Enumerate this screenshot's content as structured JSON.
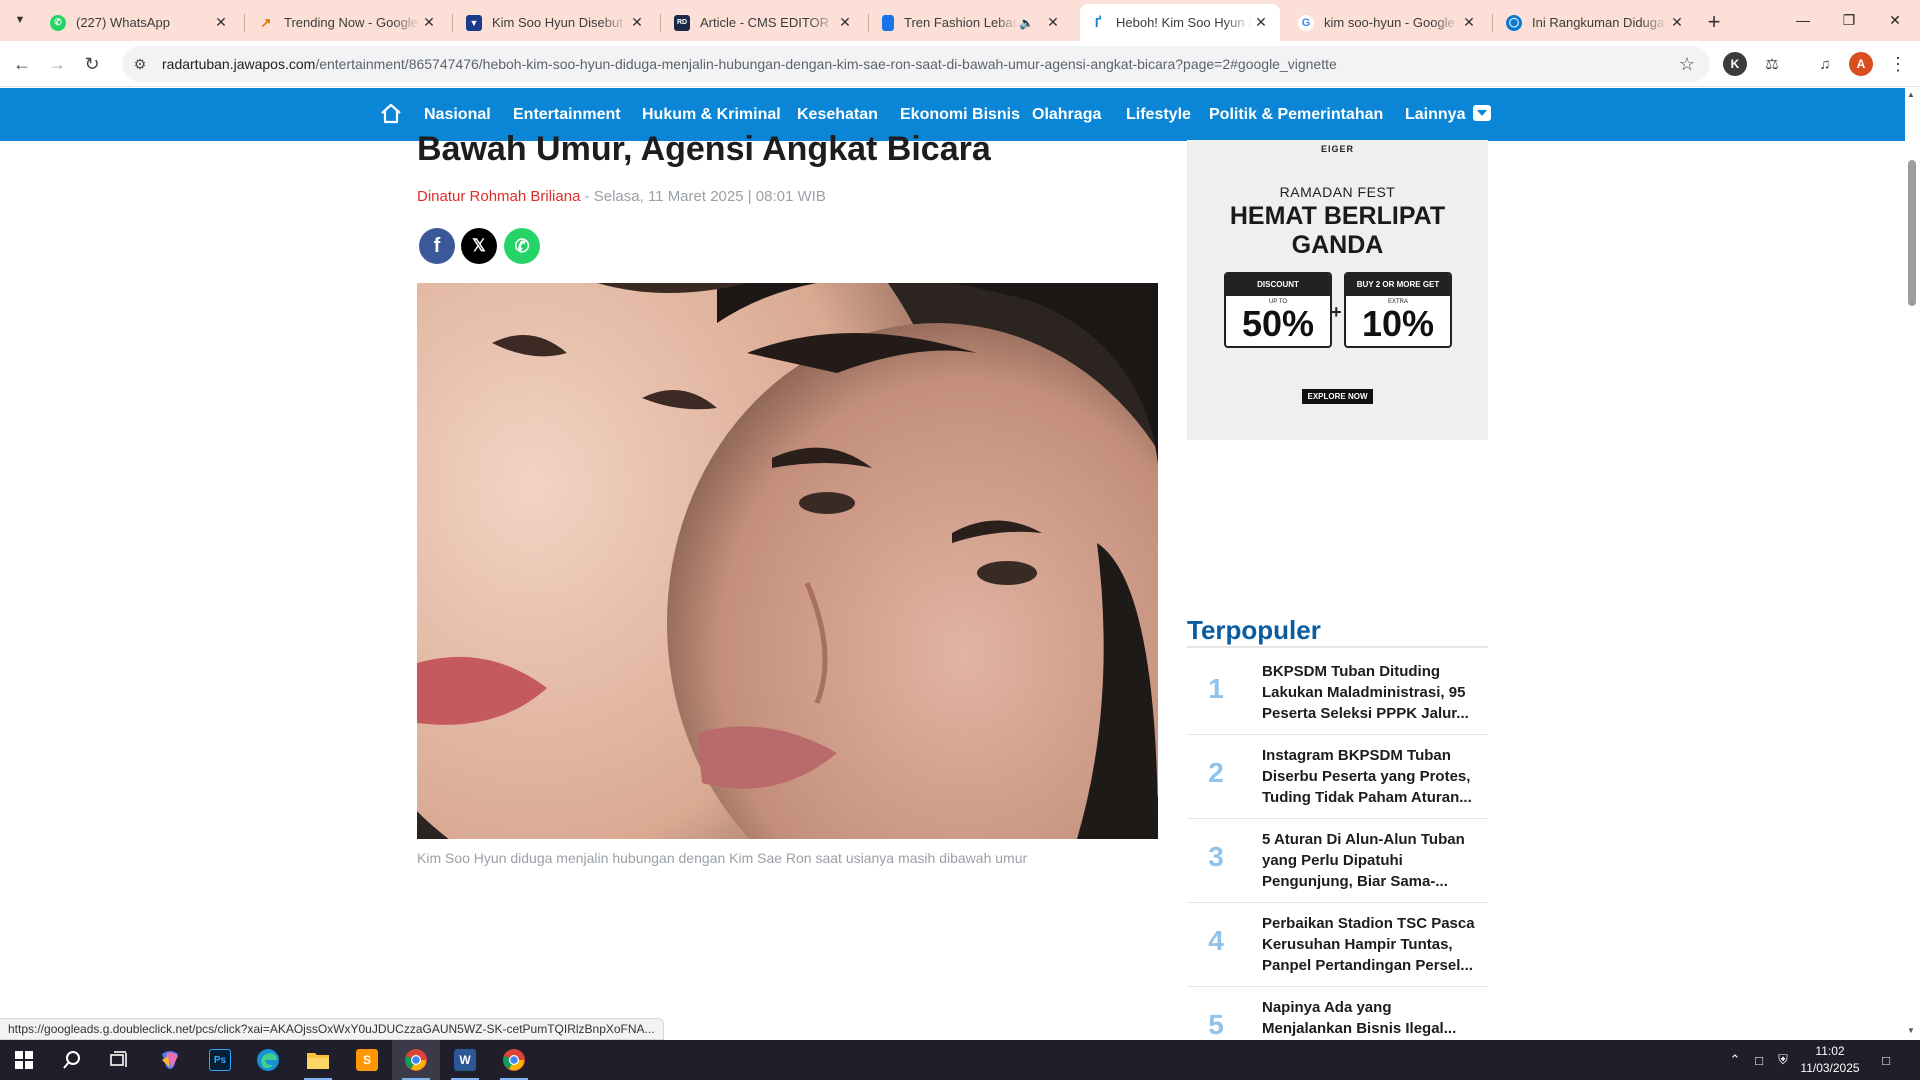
{
  "browser": {
    "tabs": [
      {
        "title": "(227) WhatsApp",
        "favicon": "whatsapp-icon",
        "color": "#25d366"
      },
      {
        "title": "Trending Now - Google Tr",
        "favicon": "google-trends-icon",
        "color": "#e37400"
      },
      {
        "title": "Kim Soo Hyun Disebut Pa",
        "favicon": "site-logo-icon",
        "color": "#1a3a8a"
      },
      {
        "title": "Article - CMS EDITOR",
        "favicon": "cms-icon",
        "color": "#1b2a4a"
      },
      {
        "title": "Tren Fashion Lebaran",
        "favicon": "bookmark-icon",
        "color": "#1a73e8"
      },
      {
        "title": "Heboh! Kim Soo Hyun Di",
        "favicon": "radar-icon",
        "color": "#0b86d6"
      },
      {
        "title": "kim soo-hyun - Google Se",
        "favicon": "google-icon",
        "color": "#4285f4"
      },
      {
        "title": "Ini Rangkuman Diduga Pe",
        "favicon": "globe-icon",
        "color": "#0a7bd0"
      }
    ],
    "active_tab": 5,
    "url_host": "radartuban.jawapos.com",
    "url_path": "/entertainment/865747476/heboh-kim-soo-hyun-diduga-menjalin-hubungan-dengan-kim-sae-ron-saat-di-bawah-umur-agensi-angkat-bicara?page=2#google_vignette",
    "profile_initial": "A",
    "extension_initial": "K"
  },
  "site": {
    "nav": [
      "Nasional",
      "Entertainment",
      "Hukum & Kriminal",
      "Kesehatan",
      "Ekonomi Bisnis",
      "Olahraga",
      "Lifestyle",
      "Politik & Pemerintahan",
      "Lainnya"
    ],
    "brand_color": "#0b86d6"
  },
  "article": {
    "headline": "Bawah Umur, Agensi Angkat Bicara",
    "author": "Dinatur Rohmah Briliana",
    "date": " - Selasa, 11 Maret 2025 | 08:01 WIB",
    "caption": "Kim Soo Hyun diduga menjalin hubungan dengan Kim Sae Ron saat usianya masih dibawah umur"
  },
  "ad": {
    "brand": "EIGER",
    "event": "RAMADAN FEST",
    "headline_1": "HEMAT BERLIPAT",
    "headline_2": "GANDA",
    "box1_header": "DISCOUNT",
    "box1_sub": "UP TO",
    "box1_value": "50%",
    "box2_header": "BUY 2 OR MORE GET",
    "box2_sub": "EXTRA",
    "box2_value": "10%",
    "plus": "+",
    "cta": "EXPLORE NOW"
  },
  "sidebar": {
    "popular_title": "Terpopuler",
    "popular": [
      {
        "rank": "1",
        "title": "BKPSDM Tuban Dituding Lakukan Maladministrasi, 95 Peserta Seleksi PPPK Jalur..."
      },
      {
        "rank": "2",
        "title": "Instagram BKPSDM Tuban Diserbu Peserta yang Protes, Tuding Tidak Paham Aturan..."
      },
      {
        "rank": "3",
        "title": "5 Aturan Di Alun-Alun Tuban yang Perlu Dipatuhi Pengunjung, Biar Sama-..."
      },
      {
        "rank": "4",
        "title": "Perbaikan Stadion TSC Pasca Kerusuhan Hampir Tuntas, Panpel Pertandingan Persel..."
      },
      {
        "rank": "5",
        "title": "Napinya Ada yang Menjalankan Bisnis Ilegal..."
      }
    ]
  },
  "status_link": "https://googleads.g.doubleclick.net/pcs/click?xai=AKAOjssOxWxY0uJDUCzzaGAUN5WZ-SK-cetPumTQIRlzBnpXoFNA...",
  "taskbar": {
    "time": "11:02",
    "date": "11/03/2025"
  }
}
